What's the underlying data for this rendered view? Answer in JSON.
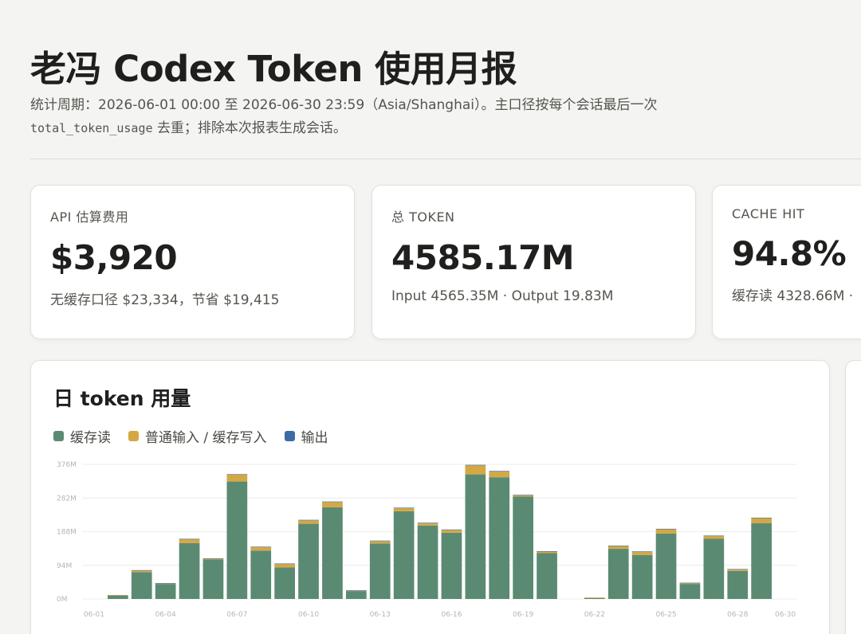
{
  "header": {
    "title": "老冯 Codex Token 使用月报",
    "subtitle_part1": "统计周期：2026-06-01 00:00 至 2026-06-30 23:59（Asia/Shanghai）。主口径按每个会话最后一次",
    "subtitle_code": "total_token_usage",
    "subtitle_part2": "去重；排除本次报表生成会话。"
  },
  "kpis": [
    {
      "label": "API 估算费用",
      "value": "$3,920",
      "sub": "无缓存口径 $23,334，节省 $19,415"
    },
    {
      "label": "总 TOKEN",
      "value": "4585.17M",
      "sub": "Input 4565.35M · Output 19.83M"
    },
    {
      "label": "CACHE HIT",
      "value": "94.8%",
      "sub": "缓存读 4328.66M ·"
    }
  ],
  "chart": {
    "title": "日 token 用量",
    "legend": [
      {
        "label": "缓存读",
        "color": "#5b8a73"
      },
      {
        "label": "普通输入 / 缓存写入",
        "color": "#d4a843"
      },
      {
        "label": "输出",
        "color": "#3f6aa8"
      }
    ]
  },
  "chart_data": {
    "type": "bar",
    "stacked": true,
    "categories": [
      "06-01",
      "06-02",
      "06-03",
      "06-04",
      "06-05",
      "06-06",
      "06-07",
      "06-08",
      "06-09",
      "06-10",
      "06-11",
      "06-12",
      "06-13",
      "06-14",
      "06-15",
      "06-16",
      "06-17",
      "06-18",
      "06-19",
      "06-20",
      "06-21",
      "06-22",
      "06-23",
      "06-24",
      "06-25",
      "06-26",
      "06-27",
      "06-28",
      "06-29",
      "06-30"
    ],
    "x_tick_labels": [
      "06-01",
      "06-04",
      "06-07",
      "06-10",
      "06-13",
      "06-16",
      "06-19",
      "06-22",
      "06-25",
      "06-28",
      "06-30"
    ],
    "y_tick_labels": [
      "0M",
      "94M",
      "188M",
      "282M",
      "376M"
    ],
    "ylim": [
      0,
      376
    ],
    "grid": true,
    "series": [
      {
        "name": "缓存读",
        "color": "#5b8a73",
        "values": [
          0,
          10,
          75,
          42,
          156,
          110,
          328,
          135,
          88,
          210,
          256,
          22,
          155,
          245,
          205,
          185,
          348,
          340,
          286,
          128,
          0,
          3,
          140,
          123,
          183,
          42,
          168,
          78,
          212,
          0
        ]
      },
      {
        "name": "普通输入 / 缓存写入",
        "color": "#d4a843",
        "values": [
          0,
          1,
          5,
          2,
          11,
          3,
          19,
          10,
          10,
          10,
          15,
          2,
          7,
          9,
          7,
          8,
          25,
          16,
          4,
          5,
          0,
          1,
          8,
          9,
          12,
          3,
          8,
          5,
          14,
          0
        ]
      },
      {
        "name": "输出",
        "color": "#3f6aa8",
        "values": [
          0,
          0,
          0.5,
          0.3,
          1,
          0.5,
          1.5,
          1,
          1,
          1,
          1.2,
          0.1,
          1,
          1,
          1,
          1,
          1.5,
          1.5,
          1,
          0.5,
          0,
          0,
          1,
          1,
          1,
          0.3,
          1,
          0.5,
          1,
          0
        ]
      }
    ]
  }
}
